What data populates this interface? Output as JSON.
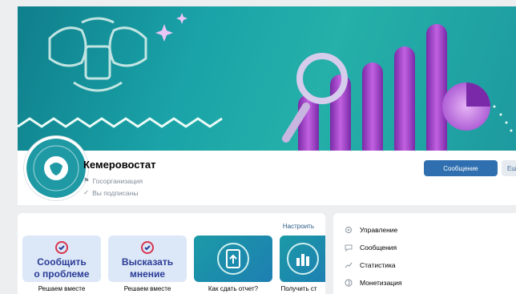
{
  "group": {
    "name": "Кемеровостат",
    "type": "Госорганизация",
    "subscription": "Вы подписаны"
  },
  "actions": {
    "message_label": "Сообщение",
    "more_label": "Ещё"
  },
  "widgets": {
    "customize_label": "Настроить",
    "tiles": [
      {
        "title_line1": "Сообщить",
        "title_line2": "о проблеме",
        "caption": "Решаем вместе"
      },
      {
        "title_line1": "Высказать",
        "title_line2": "мнение",
        "caption": "Решаем вместе"
      },
      {
        "caption": "Как сдать отчет?"
      },
      {
        "caption": "Получить ст"
      }
    ]
  },
  "menu": {
    "items": [
      {
        "label": "Управление",
        "icon": "gear-icon"
      },
      {
        "label": "Сообщения",
        "icon": "chat-icon"
      },
      {
        "label": "Статистика",
        "icon": "chart-icon"
      },
      {
        "label": "Монетизация",
        "icon": "coin-icon"
      }
    ]
  },
  "colors": {
    "accent": "#2f6fb0",
    "cover_teal": "#1aa3a8",
    "purple": "#9b3fc2"
  }
}
